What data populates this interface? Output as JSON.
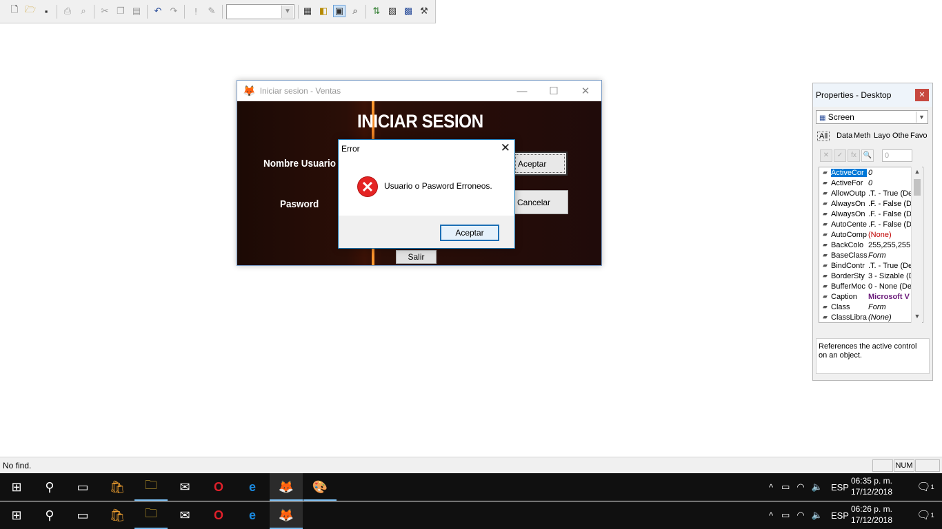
{
  "toolbar": {
    "icons": [
      "new-file-icon",
      "open-folder-icon",
      "save-icon",
      "print-icon",
      "print-preview-icon",
      "cut-icon",
      "copy-icon",
      "paste-icon",
      "undo-icon",
      "redo-icon",
      "run-icon",
      "modify-icon",
      "form-icon",
      "class-icon",
      "properties-icon",
      "view-icon",
      "data-env-icon",
      "builder-icon",
      "toolbox-icon",
      "code-icon"
    ],
    "combo_value": ""
  },
  "app_window": {
    "title": "Iniciar sesion - Ventas",
    "heading": "INICIAR SESION",
    "user_label": "Nombre Usuario",
    "password_label": "Pasword",
    "accept_button": "Aceptar",
    "cancel_button": "Cancelar",
    "exit_button": "Salir"
  },
  "error_dialog": {
    "title": "Error",
    "message": "Usuario o Pasword Erroneos.",
    "ok_button": "Aceptar",
    "icon": "error-icon"
  },
  "properties": {
    "title": "Properties - Desktop",
    "object_combo": "Screen",
    "tabs": [
      "All",
      "Data",
      "Meth",
      "Layo",
      "Othe",
      "Favo"
    ],
    "value_box": "0",
    "rows": [
      {
        "name": "ActiveCor",
        "value": "0",
        "selected": true,
        "style": "italic"
      },
      {
        "name": "ActiveFor",
        "value": "0",
        "style": "italic"
      },
      {
        "name": "AllowOutp",
        "value": ".T. - True (De",
        "style": "normal"
      },
      {
        "name": "AlwaysOn",
        "value": ".F. - False (D",
        "style": "normal"
      },
      {
        "name": "AlwaysOn",
        "value": ".F. - False (D",
        "style": "normal"
      },
      {
        "name": "AutoCente",
        "value": ".F. - False (D",
        "style": "normal"
      },
      {
        "name": "AutoComp",
        "value": "(None)",
        "style": "red"
      },
      {
        "name": "BackColo",
        "value": "255,255,255",
        "style": "normal"
      },
      {
        "name": "BaseClass",
        "value": "Form",
        "style": "italic"
      },
      {
        "name": "BindContr",
        "value": ".T. - True (De",
        "style": "normal"
      },
      {
        "name": "BorderSty",
        "value": "3 - Sizable (D",
        "style": "normal"
      },
      {
        "name": "BufferMoc",
        "value": "0 - None (De",
        "style": "normal"
      },
      {
        "name": "Caption",
        "value": "Microsoft V",
        "style": "bold"
      },
      {
        "name": "Class",
        "value": "Form",
        "style": "italic"
      },
      {
        "name": "ClassLibra",
        "value": "(None)",
        "style": "italic"
      }
    ],
    "description": "References the active control on an object."
  },
  "statusbar": {
    "text": "No find.",
    "num": "NUM"
  },
  "taskbar_top": {
    "time": "06:35 p. m.",
    "date": "17/12/2018",
    "lang": "ESP",
    "notif": "1"
  },
  "taskbar_bottom": {
    "time": "06:26 p. m.",
    "date": "17/12/2018",
    "lang": "ESP",
    "notif": "1"
  },
  "colors": {
    "accent": "#0078d7",
    "taskbar": "#101010",
    "close_red": "#c7483f",
    "error_red": "#e52424"
  }
}
